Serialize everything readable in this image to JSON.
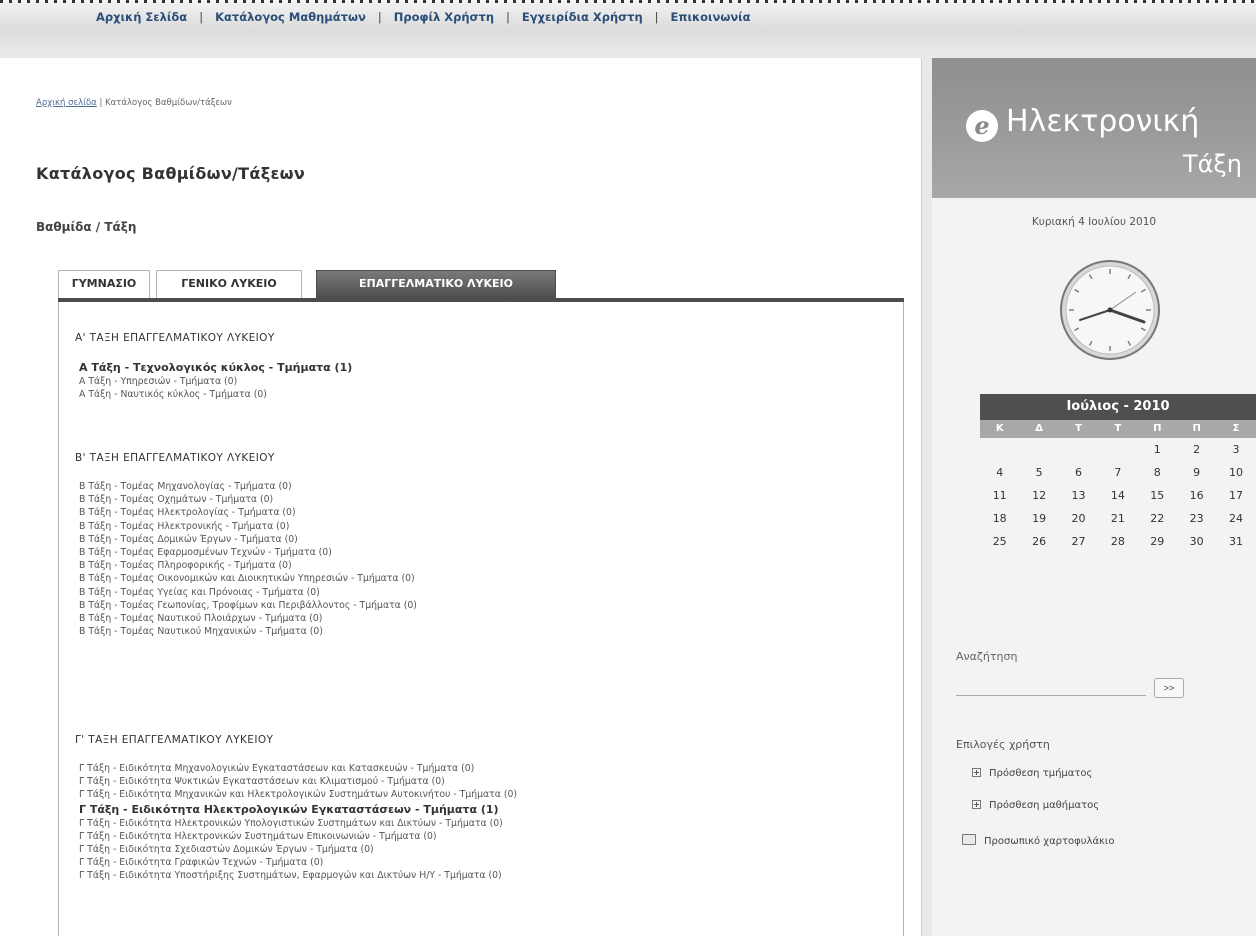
{
  "nav": {
    "items": [
      "Αρχική Σελίδα",
      "Κατάλογος Μαθημάτων",
      "Προφίλ Χρήστη",
      "Εγχειρίδια Χρήστη",
      "Επικοινωνία"
    ],
    "separator": "|"
  },
  "breadcrumb": {
    "home": "Αρχική σελίδα",
    "current": "Κατάλογος Βαθμίδων/τάξεων"
  },
  "page_title": "Κατάλογος Βαθμίδων/Τάξεων",
  "section_label": "Βαθμίδα / Τάξη",
  "tabs": [
    {
      "label": "ΓΥΜΝΑΣΙΟ",
      "active": false
    },
    {
      "label": "ΓΕΝΙΚΟ ΛΥΚΕΙΟ",
      "active": false
    },
    {
      "label": "ΕΠΑΓΓΕΛΜΑΤΙΚΟ ΛΥΚΕΙΟ",
      "active": true
    }
  ],
  "grades": [
    {
      "heading": "Α' ΤΑΞΗ ΕΠΑΓΓΕΛΜΑΤΙΚΟΥ ΛΥΚΕΙΟΥ",
      "classes": [
        {
          "text": "Α Τάξη - Τεχνολογικός κύκλος - Τμήματα (1)",
          "bold": true
        },
        {
          "text": "Α Τάξη - Υπηρεσιών - Τμήματα (0)",
          "bold": false
        },
        {
          "text": "Α Τάξη - Ναυτικός κύκλος - Τμήματα (0)",
          "bold": false
        }
      ]
    },
    {
      "heading": "Β' ΤΑΞΗ ΕΠΑΓΓΕΛΜΑΤΙΚΟΥ ΛΥΚΕΙΟΥ",
      "classes": [
        {
          "text": "Β Τάξη - Τομέας Μηχανολογίας - Τμήματα (0)",
          "bold": false
        },
        {
          "text": "Β Τάξη - Τομέας Οχημάτων - Τμήματα (0)",
          "bold": false
        },
        {
          "text": "Β Τάξη - Τομέας Ηλεκτρολογίας - Τμήματα (0)",
          "bold": false
        },
        {
          "text": "Β Τάξη - Τομέας Ηλεκτρονικής - Τμήματα (0)",
          "bold": false
        },
        {
          "text": "Β Τάξη - Τομέας Δομικών Έργων - Τμήματα (0)",
          "bold": false
        },
        {
          "text": "Β Τάξη - Τομέας Εφαρμοσμένων Τεχνών - Τμήματα (0)",
          "bold": false
        },
        {
          "text": "Β Τάξη - Τομέας Πληροφορικής - Τμήματα (0)",
          "bold": false
        },
        {
          "text": "Β Τάξη - Τομέας Οικονομικών και Διοικητικών Υπηρεσιών - Τμήματα (0)",
          "bold": false
        },
        {
          "text": "Β Τάξη - Τομέας Υγείας και Πρόνοιας - Τμήματα (0)",
          "bold": false
        },
        {
          "text": "Β Τάξη - Τομέας Γεωπονίας, Τροφίμων και Περιβάλλοντος - Τμήματα (0)",
          "bold": false
        },
        {
          "text": "Β Τάξη - Τομέας Ναυτικού Πλοιάρχων - Τμήματα (0)",
          "bold": false
        },
        {
          "text": "Β Τάξη - Τομέας Ναυτικού Μηχανικών - Τμήματα (0)",
          "bold": false
        }
      ]
    },
    {
      "heading": "Γ' ΤΑΞΗ ΕΠΑΓΓΕΛΜΑΤΙΚΟΥ ΛΥΚΕΙΟΥ",
      "classes": [
        {
          "text": "Γ Τάξη - Ειδικότητα Μηχανολογικών Εγκαταστάσεων και Κατασκευών - Τμήματα (0)",
          "bold": false
        },
        {
          "text": "Γ Τάξη - Ειδικότητα Ψυκτικών Εγκαταστάσεων και Κλιματισμού - Τμήματα (0)",
          "bold": false
        },
        {
          "text": "Γ Τάξη - Ειδικότητα Μηχανικών και Ηλεκτρολογικών Συστημάτων Αυτοκινήτου - Τμήματα (0)",
          "bold": false
        },
        {
          "text": "Γ Τάξη - Ειδικότητα Ηλεκτρολογικών Εγκαταστάσεων - Τμήματα (1)",
          "bold": true
        },
        {
          "text": "Γ Τάξη - Ειδικότητα Ηλεκτρονικών Υπολογιστικών Συστημάτων και Δικτύων - Τμήματα (0)",
          "bold": false
        },
        {
          "text": "Γ Τάξη - Ειδικότητα Ηλεκτρονικών Συστημάτων Επικοινωνιών - Τμήματα (0)",
          "bold": false
        },
        {
          "text": "Γ Τάξη - Ειδικότητα Σχεδιαστών Δομικών Έργων - Τμήματα (0)",
          "bold": false
        },
        {
          "text": "Γ Τάξη - Ειδικότητα Γραφικών Τεχνών - Τμήματα (0)",
          "bold": false
        },
        {
          "text": "Γ Τάξη - Ειδικότητα Υποστήριξης Συστημάτων, Εφαρμογών και Δικτύων Η/Υ - Τμήματα (0)",
          "bold": false
        }
      ]
    }
  ],
  "sidebar": {
    "logo_line1": "Ηλεκτρονική",
    "logo_line2": "Τάξη",
    "date": "Κυριακή 4 Ιουλίου 2010",
    "calendar": {
      "title": "Ιούλιος - 2010",
      "weekdays": [
        "Κ",
        "Δ",
        "Τ",
        "Τ",
        "Π",
        "Π",
        "Σ"
      ],
      "weeks": [
        [
          "",
          "",
          "",
          "",
          "1",
          "2",
          "3"
        ],
        [
          "4",
          "5",
          "6",
          "7",
          "8",
          "9",
          "10"
        ],
        [
          "11",
          "12",
          "13",
          "14",
          "15",
          "16",
          "17"
        ],
        [
          "18",
          "19",
          "20",
          "21",
          "22",
          "23",
          "24"
        ],
        [
          "25",
          "26",
          "27",
          "28",
          "29",
          "30",
          "31"
        ]
      ]
    },
    "search_label": "Αναζήτηση",
    "search_value": "",
    "search_button": ">>",
    "options_title": "Επιλογές χρήστη",
    "options": [
      {
        "label": "Πρόσθεση τμήματος",
        "icon": "plus-box-icon"
      },
      {
        "label": "Πρόσθεση μαθήματος",
        "icon": "plus-box-icon"
      },
      {
        "label": "Προσωπικό χαρτοφυλάκιο",
        "icon": "folder-icon"
      }
    ]
  },
  "colors": {
    "nav_link": "#2b4f79",
    "tab_active": "#4d4d4d",
    "calendar_head": "#4f4f4f"
  }
}
